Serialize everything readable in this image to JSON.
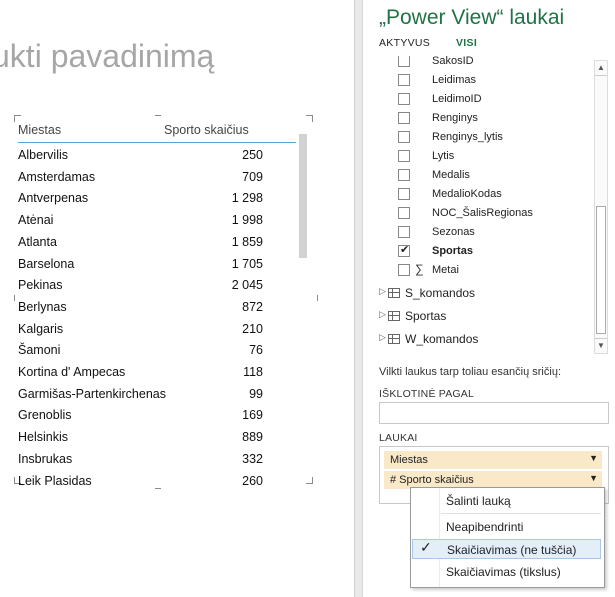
{
  "canvas": {
    "title": "ukti pavadinimą",
    "table": {
      "headers": [
        "Miestas",
        "Sporto skaičius"
      ],
      "rows": [
        [
          "Albervilis",
          "250"
        ],
        [
          "Amsterdamas",
          "709"
        ],
        [
          "Antverpenas",
          "1 298"
        ],
        [
          "Atėnai",
          "1 998"
        ],
        [
          "Atlanta",
          "1 859"
        ],
        [
          "Barselona",
          "1 705"
        ],
        [
          "Pekinas",
          "2 045"
        ],
        [
          "Berlynas",
          "872"
        ],
        [
          "Kalgaris",
          "210"
        ],
        [
          "Šamoni",
          "76"
        ],
        [
          "Kortina d' Ampecas",
          "118"
        ],
        [
          "Garmišas-Partenkirchenas",
          "99"
        ],
        [
          "Grenoblis",
          "169"
        ],
        [
          "Helsinkis",
          "889"
        ],
        [
          "Insbrukas",
          "332"
        ],
        [
          "Leik Plasidas",
          "260"
        ]
      ]
    }
  },
  "pane": {
    "title": "„Power View“ laukai",
    "tab_active": "AKTYVUS",
    "tab_all": "VISI",
    "fields": [
      {
        "label": "SakosID",
        "checked": false,
        "bold": false
      },
      {
        "label": "Leidimas",
        "checked": false,
        "bold": false
      },
      {
        "label": "LeidimoID",
        "checked": false,
        "bold": false
      },
      {
        "label": "Renginys",
        "checked": false,
        "bold": false
      },
      {
        "label": "Renginys_lytis",
        "checked": false,
        "bold": false
      },
      {
        "label": "Lytis",
        "checked": false,
        "bold": false
      },
      {
        "label": "Medalis",
        "checked": false,
        "bold": false
      },
      {
        "label": "MedalioKodas",
        "checked": false,
        "bold": false
      },
      {
        "label": "NOC_ŠalisRegionas",
        "checked": false,
        "bold": false
      },
      {
        "label": "Sezonas",
        "checked": false,
        "bold": false
      },
      {
        "label": "Sportas",
        "checked": true,
        "bold": true
      },
      {
        "label": "Metai",
        "checked": false,
        "bold": false,
        "sigma": true
      }
    ],
    "tables": [
      "S_komandos",
      "Sportas",
      "W_komandos"
    ],
    "drag_hint": "Vilkti laukus tarp toliau esančių sričių:",
    "filter_label": "IŠKLOTINĖ PAGAL",
    "fields_label": "LAUKAI",
    "wells": [
      "Miestas",
      "# Sporto skaičius"
    ]
  },
  "menu": {
    "items": [
      {
        "label": "Šalinti lauką",
        "selected": false,
        "checked": false
      },
      {
        "label": "Neapibendrinti",
        "selected": false,
        "checked": false
      },
      {
        "label": "Skaičiavimas (ne tuščia)",
        "selected": true,
        "checked": true
      },
      {
        "label": "Skaičiavimas (tikslus)",
        "selected": false,
        "checked": false
      }
    ]
  }
}
